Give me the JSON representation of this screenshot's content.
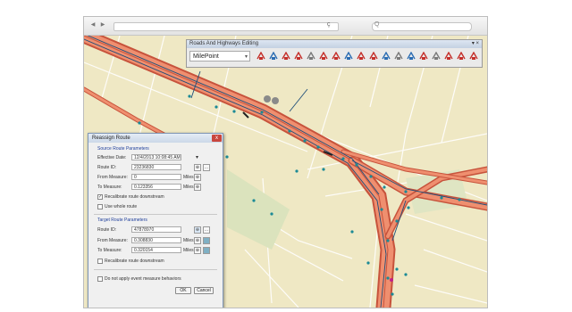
{
  "browser": {
    "back_icon": "back-arrow-icon",
    "forward_icon": "forward-arrow-icon",
    "reload_icon": "reload-icon",
    "search_icon": "search-icon",
    "back_glyph": "◀",
    "forward_glyph": "▶",
    "reload_glyph": "ç",
    "search_glyph": "Q"
  },
  "toolbar": {
    "title": "Roads And Highways Editing",
    "close_glyph": "▾ ×",
    "selected_layer": "MilePoint",
    "dropdown_glyph": "▾",
    "tool_icons": [
      "route-edit-icon",
      "calibrate-icon",
      "retire-route-icon",
      "extend-route-icon",
      "reassign-route-icon",
      "realign-route-icon",
      "reverse-route-icon",
      "cartographic-realign-icon",
      "create-route-icon",
      "event-icon",
      "point-event-icon",
      "line-event-icon",
      "locate-icon",
      "attribute-icon",
      "table-icon",
      "record-icon",
      "home-icon",
      "remove-icon"
    ]
  },
  "dialog": {
    "title": "Reassign Route",
    "close_glyph": "x",
    "source_group": "Source Route Parameters",
    "target_group": "Target Route Parameters",
    "effective_date_label": "Effective Date:",
    "effective_date_value": "12/4/2013 10:08:45 AM",
    "source_route_label": "Route ID:",
    "source_route_value": "23236830",
    "source_from_label": "From Measure:",
    "source_from_value": "0",
    "source_to_label": "To Measure:",
    "source_to_value": "0.123356",
    "units": "Miles",
    "recalibrate_source_label": "Recalibrate route downstream",
    "retire_source_label": "Use whole route",
    "target_route_label": "Route ID:",
    "target_route_value": "47878970",
    "target_from_label": "From Measure:",
    "target_from_value": "0.308830",
    "target_to_label": "To Measure:",
    "target_to_value": "0.320154",
    "recalibrate_target_label": "Recalibrate route downstream",
    "no_event_label": "Do not apply event measure behaviors",
    "ok_label": "OK",
    "cancel_label": "Cancel",
    "dropdown_glyph": "▾",
    "more_glyph": "...",
    "check_glyph": "✓",
    "pick_glyph": "⊕"
  },
  "colors": {
    "map_background": "#efe8c4",
    "highway_fill": "#ef8f6f",
    "highway_casing": "#c7533c",
    "route_line": "#1f4e7a",
    "route_vertex": "#1b8a96",
    "toolbar_icon_red": "#c4302b"
  }
}
